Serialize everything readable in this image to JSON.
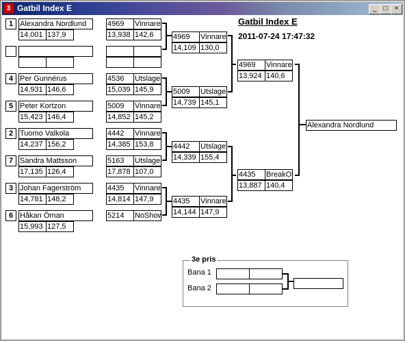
{
  "window": {
    "title": "Gatbil Index E",
    "icon": "app-icon",
    "buttons": [
      "minimize",
      "maximize",
      "close"
    ]
  },
  "header": {
    "title": "Gatbil Index E",
    "datetime": "2011-07-24 17:47:32"
  },
  "round1": [
    {
      "seed": "1",
      "name": "Alexandra Nordlund",
      "rt": "14,001",
      "speed": "137,9",
      "id": "4969",
      "result": "Vinnare",
      "t2": "13,938",
      "s2": "142,6"
    },
    {
      "seed": "",
      "name": "",
      "rt": "",
      "speed": "",
      "id": "",
      "result": "",
      "t2": "",
      "s2": ""
    },
    {
      "seed": "4",
      "name": "Per Gunnérus",
      "rt": "14,931",
      "speed": "146,6",
      "id": "4536",
      "result": "Utslagen",
      "t2": "15,039",
      "s2": "145,9"
    },
    {
      "seed": "5",
      "name": "Peter Kortzon",
      "rt": "15,423",
      "speed": "146,4",
      "id": "5009",
      "result": "Vinnare",
      "t2": "14,852",
      "s2": "145,2"
    },
    {
      "seed": "2",
      "name": "Tuomo Valkola",
      "rt": "14,237",
      "speed": "156,2",
      "id": "4442",
      "result": "Vinnare",
      "t2": "14,385",
      "s2": "153,8"
    },
    {
      "seed": "7",
      "name": "Sandra Mattsson",
      "rt": "17,135",
      "speed": "126,4",
      "id": "5163",
      "result": "Utslagen",
      "t2": "17,878",
      "s2": "107,0"
    },
    {
      "seed": "3",
      "name": "Johan Fagerström",
      "rt": "14,781",
      "speed": "148,2",
      "id": "4435",
      "result": "Vinnare",
      "t2": "14,814",
      "s2": "147,9"
    },
    {
      "seed": "6",
      "name": "Håkan Öman",
      "rt": "15,993",
      "speed": "127,5",
      "id": "5214",
      "result": "NoShow",
      "t2": "",
      "s2": ""
    }
  ],
  "round2": [
    {
      "id": "4969",
      "result": "Vinnare",
      "t": "14,109",
      "s": "130,0"
    },
    {
      "id": "5009",
      "result": "Utslagen",
      "t": "14,739",
      "s": "145,1"
    },
    {
      "id": "4442",
      "result": "Utslagen",
      "t": "14,339",
      "s": "155,4"
    },
    {
      "id": "4435",
      "result": "Vinnare",
      "t": "14,144",
      "s": "147,9"
    }
  ],
  "semi": [
    {
      "id": "4969",
      "result": "Vinnare",
      "t": "13,924",
      "s": "140,6"
    },
    {
      "id": "4435",
      "result": "BreakOut",
      "t": "13,887",
      "s": "140,4"
    }
  ],
  "final": {
    "winner": "Alexandra Nordlund"
  },
  "third": {
    "legend": "3e pris",
    "lane1": "Bana 1",
    "lane2": "Bana 2"
  }
}
